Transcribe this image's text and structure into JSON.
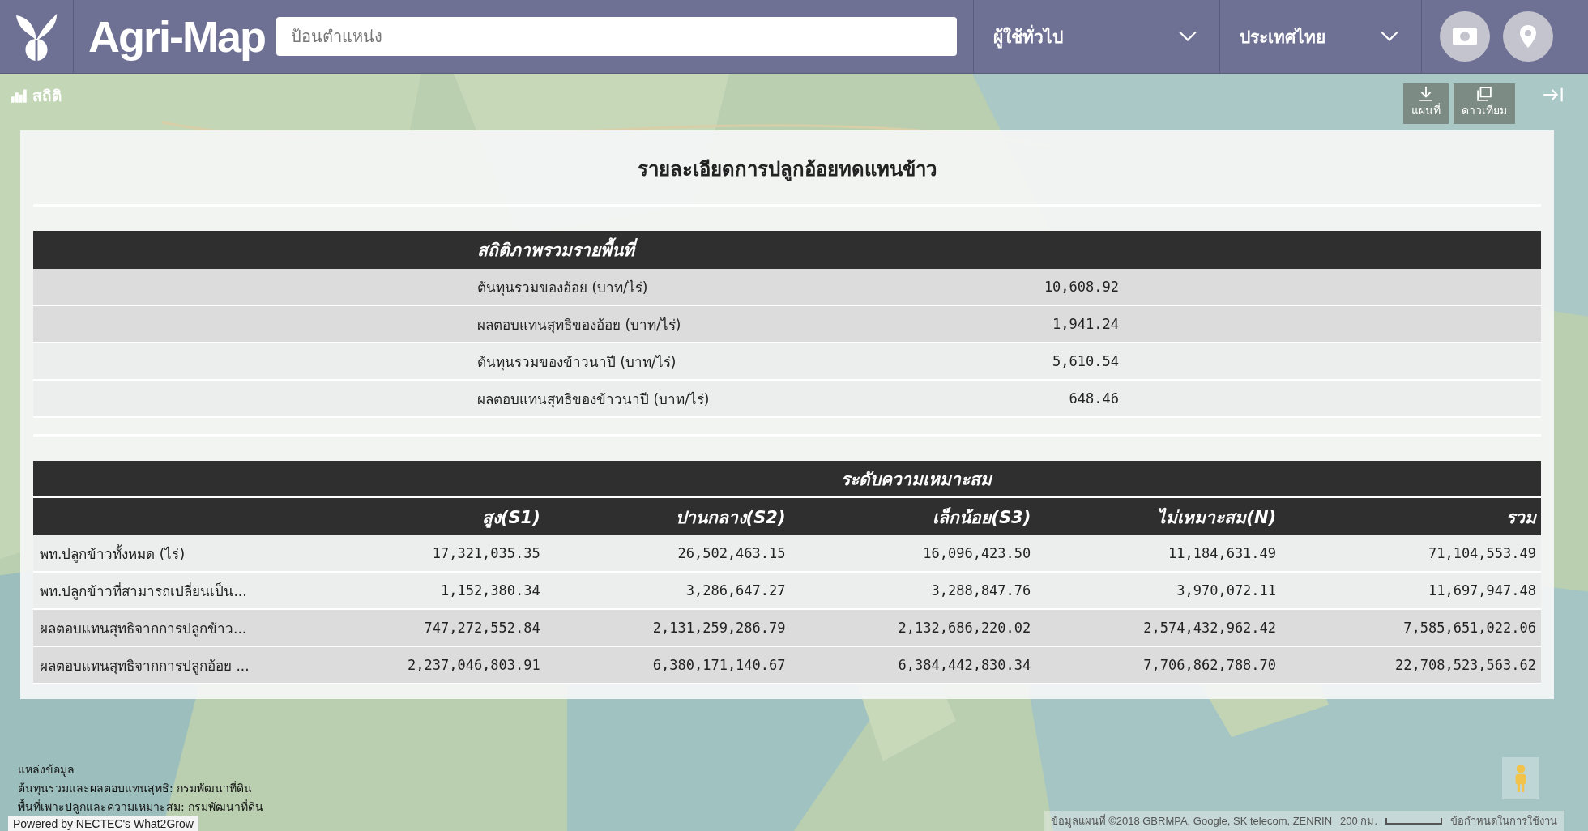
{
  "header": {
    "logo_text": "Agri-Map",
    "search": {
      "placeholder": "ป้อนตำแหน่ง"
    },
    "dropdowns": [
      {
        "label": "ผู้ใช้ทั่วไป"
      },
      {
        "label": "ประเทศไทย"
      }
    ]
  },
  "map": {
    "stats_button": "สถิติ",
    "map_types": [
      {
        "label": "แผนที่",
        "kind": "map"
      },
      {
        "label": "ดาวเทียม",
        "kind": "satellite"
      }
    ],
    "attribution": "ข้อมูลแผนที่ ©2018 GBRMPA, Google, SK telecom, ZENRIN",
    "scale": "200 กม.",
    "terms": "ข้อกำหนดในการใช้งาน"
  },
  "panel": {
    "title": "รายละเอียดการปลูกอ้อยทดแทนข้าว",
    "summary": {
      "heading": "สถิติภาพรวมรายพื้นที่",
      "rows": [
        {
          "label": "ต้นทุนรวมของอ้อย (บาท/ไร่)",
          "value": "10,608.92",
          "shaded": true
        },
        {
          "label": "ผลตอบแทนสุทธิของอ้อย (บาท/ไร่)",
          "value": "1,941.24",
          "shaded": true
        },
        {
          "label": "ต้นทุนรวมของข้าวนาปี (บาท/ไร่)",
          "value": "5,610.54",
          "shaded": false
        },
        {
          "label": "ผลตอบแทนสุทธิของข้าวนาปี (บาท/ไร่)",
          "value": "648.46",
          "shaded": false
        }
      ]
    },
    "suitability": {
      "group_heading": "ระดับความเหมาะสม",
      "columns": [
        "สูง(S1)",
        "ปานกลาง(S2)",
        "เล็กน้อย(S3)",
        "ไม่เหมาะสม(N)",
        "รวม"
      ],
      "rows": [
        {
          "label": "พท.ปลูกข้าวทั้งหมด (ไร่)",
          "values": [
            "17,321,035.35",
            "26,502,463.15",
            "16,096,423.50",
            "11,184,631.49",
            "71,104,553.49"
          ],
          "shaded": false
        },
        {
          "label": "พท.ปลูกข้าวที่สามารถเปลี่ยนเป็น...",
          "values": [
            "1,152,380.34",
            "3,286,647.27",
            "3,288,847.76",
            "3,970,072.11",
            "11,697,947.48"
          ],
          "shaded": false
        },
        {
          "label": "ผลตอบแทนสุทธิจากการปลูกข้าว...",
          "values": [
            "747,272,552.84",
            "2,131,259,286.79",
            "2,132,686,220.02",
            "2,574,432,962.42",
            "7,585,651,022.06"
          ],
          "shaded": true
        },
        {
          "label": "ผลตอบแทนสุทธิจากการปลูกอ้อย ...",
          "values": [
            "2,237,046,803.91",
            "6,380,171,140.67",
            "6,384,442,830.34",
            "7,706,862,788.70",
            "22,708,523,563.62"
          ],
          "shaded": true
        }
      ]
    }
  },
  "sources": {
    "title": "แหล่งข้อมูล",
    "lines": [
      "ต้นทุนรวมและผลตอบแทนสุทธิ: กรมพัฒนาที่ดิน",
      "พื้นที่เพาะปลูกและความเหมาะสม: กรมพัฒนาที่ดิน"
    ]
  },
  "powered_by": "Powered by NECTEC's What2Grow"
}
